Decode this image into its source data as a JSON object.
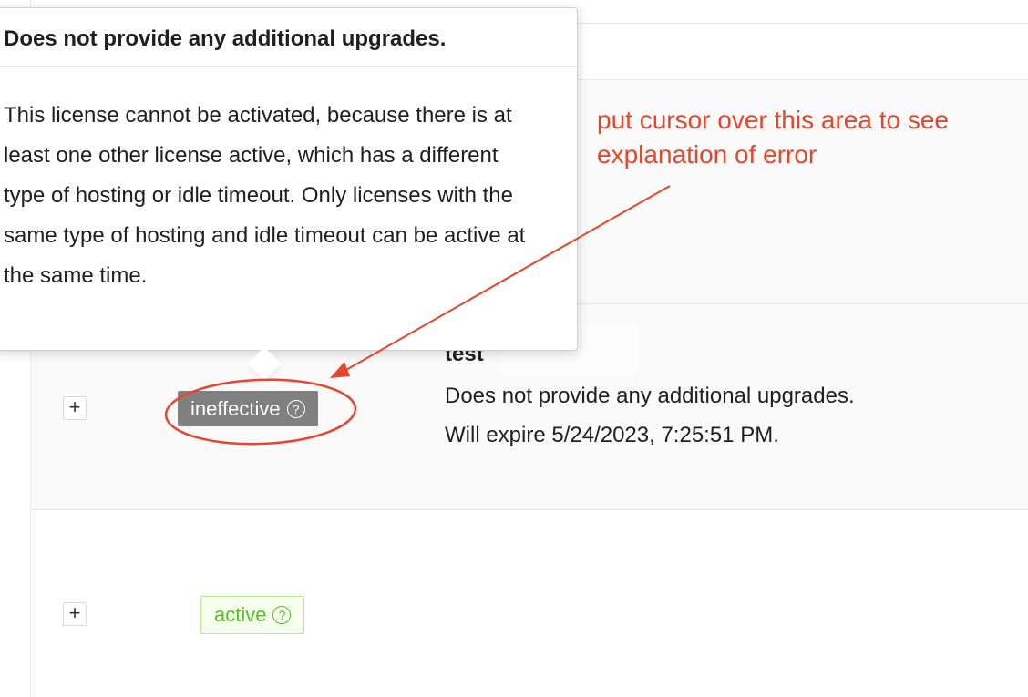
{
  "popover": {
    "title": "Does not provide any additional upgrades.",
    "body": "This license cannot be activated, because there is at least one other license active, which has a different type of hosting or idle timeout. Only licenses with the same type of hosting and idle timeout can be active at the same time."
  },
  "rows": [
    {
      "expand_label": "+",
      "status": "ineffective",
      "status_color": "#808080",
      "name": "test",
      "description": "Does not provide any additional upgrades.",
      "expiry": "Will expire 5/24/2023, 7:25:51 PM."
    },
    {
      "expand_label": "+",
      "status": "active",
      "status_color": "#52c41a"
    }
  ],
  "annotation": {
    "text": "put cursor over this area to see explanation of error",
    "color": "#e8452c"
  },
  "icons": {
    "help": "?"
  }
}
